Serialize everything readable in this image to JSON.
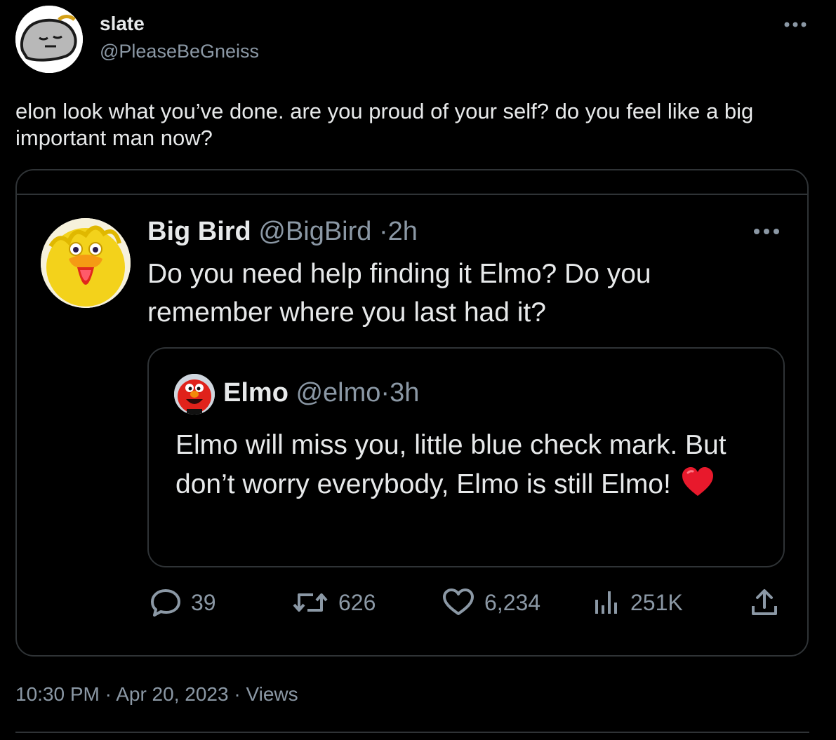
{
  "tweet": {
    "author_name": "slate",
    "author_handle": "@PleaseBeGneiss",
    "text": "elon look what you’ve done. are you proud of your self? do you feel like a big important man now?",
    "time": "10:30 PM",
    "date": "Apr 20, 2023",
    "views_label": "Views",
    "separator": "·"
  },
  "quoted": {
    "name": "Big Bird",
    "handle": "@BigBird",
    "age": "2h",
    "text": "Do you need help finding it Elmo? Do you remember where you last had it?",
    "replies": "39",
    "retweets": "626",
    "likes": "6,234",
    "views": "251K"
  },
  "nested": {
    "name": "Elmo",
    "handle": "@elmo",
    "age": "3h",
    "text": "Elmo will miss you, little blue check mark. But don’t worry everybody, Elmo is still Elmo!"
  },
  "icons": {
    "more": "more-icon",
    "reply": "reply-icon",
    "retweet": "retweet-icon",
    "like": "like-icon",
    "views": "views-icon",
    "share": "share-icon",
    "emoji": "red-heart-emoji"
  },
  "colors": {
    "background": "#000000",
    "text": "#e7e9ea",
    "secondary": "#8b98a5",
    "border": "#2f3336",
    "heart": "#e8192c"
  }
}
